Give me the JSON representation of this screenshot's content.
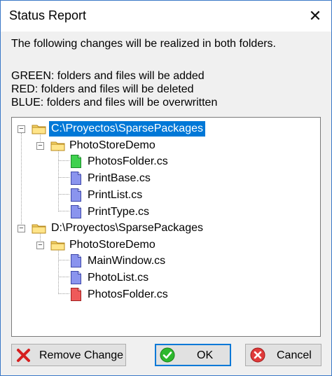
{
  "window": {
    "title": "Status Report"
  },
  "message": {
    "intro": "The following changes will be realized in both folders.",
    "legend_green": "GREEN: folders and files will be added",
    "legend_red": "RED: folders and files will be deleted",
    "legend_blue": "BLUE: folders and files will be overwritten"
  },
  "tree": {
    "root1": {
      "label": "C:\\Proyectos\\SparsePackages",
      "folder": "PhotoStoreDemo",
      "files": [
        {
          "name": "PhotosFolder.cs",
          "status": "green"
        },
        {
          "name": "PrintBase.cs",
          "status": "blue"
        },
        {
          "name": "PrintList.cs",
          "status": "blue"
        },
        {
          "name": "PrintType.cs",
          "status": "blue"
        }
      ]
    },
    "root2": {
      "label": "D:\\Proyectos\\SparsePackages",
      "folder": "PhotoStoreDemo",
      "files": [
        {
          "name": "MainWindow.cs",
          "status": "blue"
        },
        {
          "name": "PhotoList.cs",
          "status": "blue"
        },
        {
          "name": "PhotosFolder.cs",
          "status": "red"
        }
      ]
    }
  },
  "buttons": {
    "remove": "Remove Change",
    "ok": "OK",
    "cancel": "Cancel"
  },
  "colors": {
    "green": "#27c93f",
    "blue": "#7b86e6",
    "red": "#e84a4a",
    "selection": "#0078d7"
  }
}
